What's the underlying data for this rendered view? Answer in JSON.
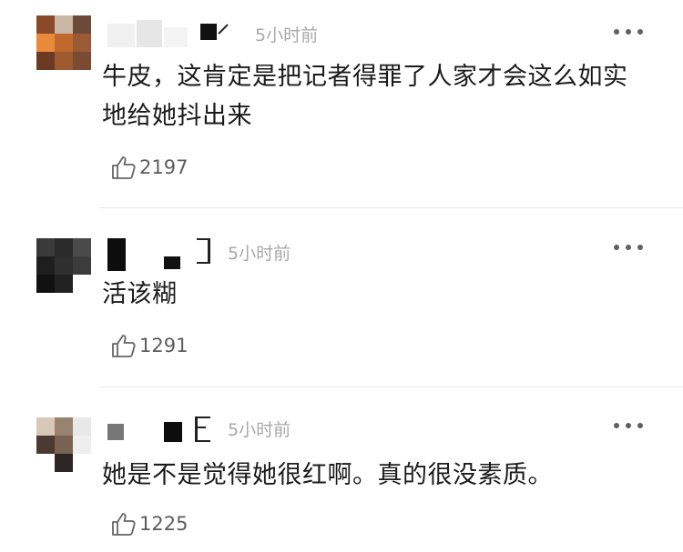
{
  "comments": [
    {
      "time": "5小时前",
      "text": "牛皮，这肯定是把记者得罪了人家才会这么如实地给她抖出来",
      "likes": "2197",
      "avatar_colors": [
        "#8a4a2a",
        "#b9a592",
        "#6b4a3a",
        "#e88a3a",
        "#c0692e",
        "#9b5a36",
        "#6a3a22",
        "#a05a30",
        "#7a4a33"
      ]
    },
    {
      "time": "5小时前",
      "text": "活该糊",
      "likes": "1291",
      "avatar_colors": [
        "#2a2a2a",
        "#3a3a3a",
        "#4a4a4a",
        "#1e1e1e",
        "#2c2c2c",
        "#3c3c3c",
        "#111111",
        "#222222",
        "#ffffff"
      ]
    },
    {
      "time": "5小时前",
      "text": "她是不是觉得她很红啊。真的很没素质。",
      "likes": "1225",
      "avatar_colors": [
        "#d8c8b8",
        "#9a8270",
        "#e8e8e8",
        "#4a3a32",
        "#7a6252",
        "#eeeeee",
        "#ffffff",
        "#2e2622",
        "#ffffff"
      ]
    }
  ],
  "icons": {
    "more": "more-dots-icon",
    "like": "thumbs-up-icon"
  }
}
